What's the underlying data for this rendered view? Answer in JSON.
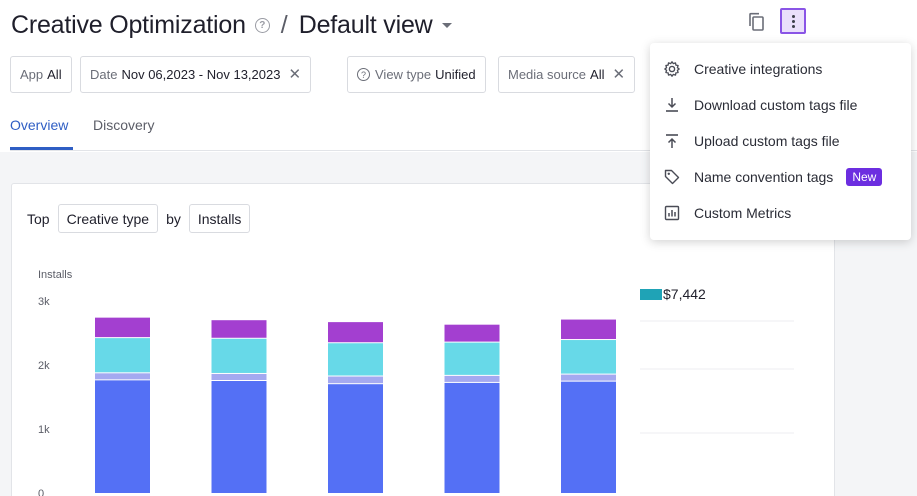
{
  "header": {
    "title": "Creative Optimization",
    "separator": "/",
    "view_name": "Default view"
  },
  "filters": [
    {
      "key": "App",
      "value": "All"
    },
    {
      "key": "Date",
      "value": "Nov 06,2023 - Nov 13,2023"
    },
    {
      "key": "View type",
      "value": "Unified"
    },
    {
      "key": "Media source",
      "value": "All"
    }
  ],
  "tabs": [
    {
      "label": "Overview",
      "active": true
    },
    {
      "label": "Discovery",
      "active": false
    }
  ],
  "chart_controls": {
    "top_label": "Top",
    "dimension": "Creative type",
    "by_label": "by",
    "metric": "Installs"
  },
  "menu": {
    "items": [
      {
        "label": "Creative integrations",
        "icon": "gear-icon"
      },
      {
        "label": "Download custom tags file",
        "icon": "download-icon"
      },
      {
        "label": "Upload custom tags file",
        "icon": "upload-icon"
      },
      {
        "label": "Name convention tags",
        "icon": "tag-icon",
        "badge": "New"
      },
      {
        "label": "Custom Metrics",
        "icon": "bar-chart-icon"
      }
    ]
  },
  "colors": {
    "accent": "#2f5ec4",
    "menu_highlight": "#8a55e6",
    "badge": "#6c2ee0",
    "series_1": "#5470f5",
    "series_2": "#a4a9f0",
    "series_3": "#67d9e8",
    "series_4": "#a33fd0",
    "legend_swatch": "#1fa3b6"
  },
  "chart_data": {
    "type": "bar",
    "ylabel": "Installs",
    "yticks": [
      "0",
      "1k",
      "2k",
      "3k"
    ],
    "ylim": [
      0,
      3000
    ],
    "categories": [
      "",
      "",
      "",
      "",
      ""
    ],
    "series": [
      {
        "values": [
          1760,
          1750,
          1700,
          1720,
          1740
        ]
      },
      {
        "values": [
          110,
          110,
          120,
          110,
          110
        ]
      },
      {
        "values": [
          550,
          550,
          520,
          520,
          540
        ]
      },
      {
        "values": [
          320,
          290,
          330,
          280,
          320
        ]
      }
    ],
    "legend_value": "$7,442"
  }
}
